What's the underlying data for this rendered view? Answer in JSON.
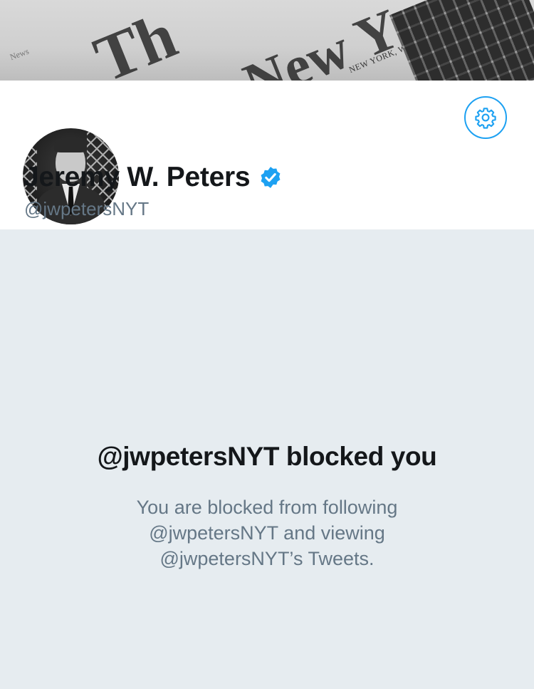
{
  "banner": {
    "masthead_left": "Th",
    "masthead_right": "New Y",
    "dateline": "NEW YORK, WEDNESDAY, JU",
    "corner_word": "News"
  },
  "profile": {
    "display_name": "Jeremy W. Peters",
    "handle": "@jwpetersNYT",
    "verified": true,
    "verified_icon": "verified-badge-icon",
    "settings_icon": "gear-icon"
  },
  "blocked_notice": {
    "title": "@jwpetersNYT blocked you",
    "message_line1": "You are blocked from following",
    "message_line2": "@jwpetersNYT and viewing",
    "message_line3": "@jwpetersNYT’s Tweets."
  },
  "colors": {
    "accent": "#1da1f2",
    "background": "#e6ecf0",
    "text_primary": "#14171a",
    "text_secondary": "#657786"
  }
}
